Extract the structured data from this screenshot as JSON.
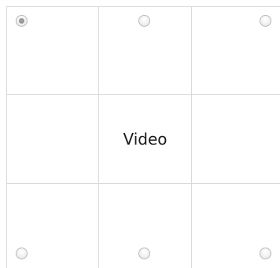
{
  "position_picker": {
    "center_label": "Video",
    "selected_position": "top-left",
    "positions": [
      {
        "key": "top-left",
        "checked": true
      },
      {
        "key": "top-center",
        "checked": false
      },
      {
        "key": "top-right",
        "checked": false
      },
      {
        "key": "bottom-left",
        "checked": false
      },
      {
        "key": "bottom-center",
        "checked": false
      },
      {
        "key": "bottom-right",
        "checked": false
      }
    ]
  }
}
